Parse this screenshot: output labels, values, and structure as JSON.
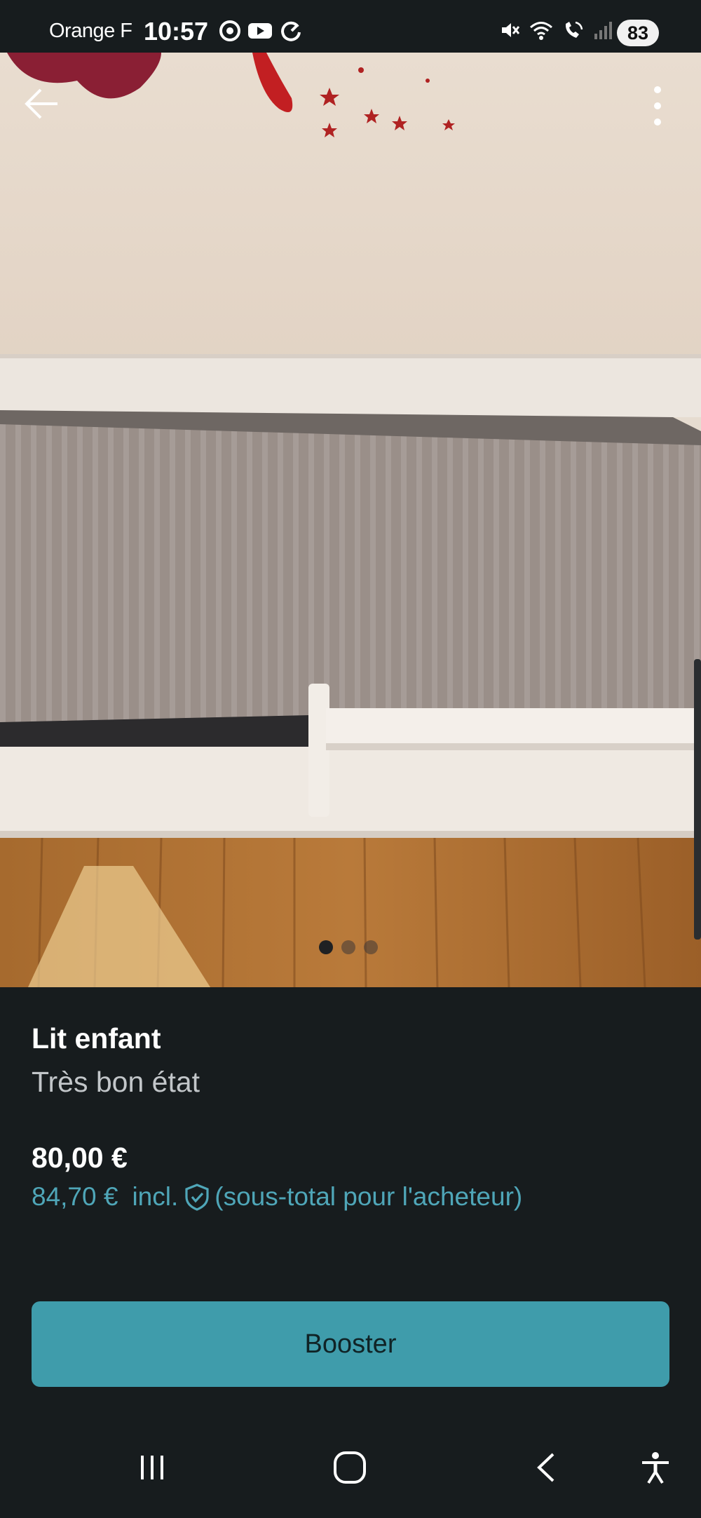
{
  "status_bar": {
    "carrier": "Orange F",
    "time": "10:57",
    "battery": "83",
    "app_icons": [
      "chrome-icon",
      "youtube-icon",
      "refresh-icon"
    ],
    "system_icons": [
      "mute-icon",
      "wifi-icon",
      "wifi-calling-icon",
      "signal-icon"
    ]
  },
  "photo": {
    "image_count": 3,
    "active_index": 0
  },
  "listing": {
    "title": "Lit enfant",
    "condition": "Très bon état",
    "price": "80,00 €",
    "buyer_price": "84,70 €",
    "incl_label": "incl.",
    "buyer_note": "(sous-total pour l'acheteur)"
  },
  "actions": {
    "booster_label": "Booster"
  },
  "colors": {
    "background": "#171c1e",
    "accent": "#3f9cab",
    "accent_text": "#4fa6b8",
    "muted_text": "#c2c6c9"
  },
  "nav": {
    "items": [
      "recent-apps-icon",
      "home-icon",
      "back-nav-icon",
      "accessibility-icon"
    ]
  }
}
